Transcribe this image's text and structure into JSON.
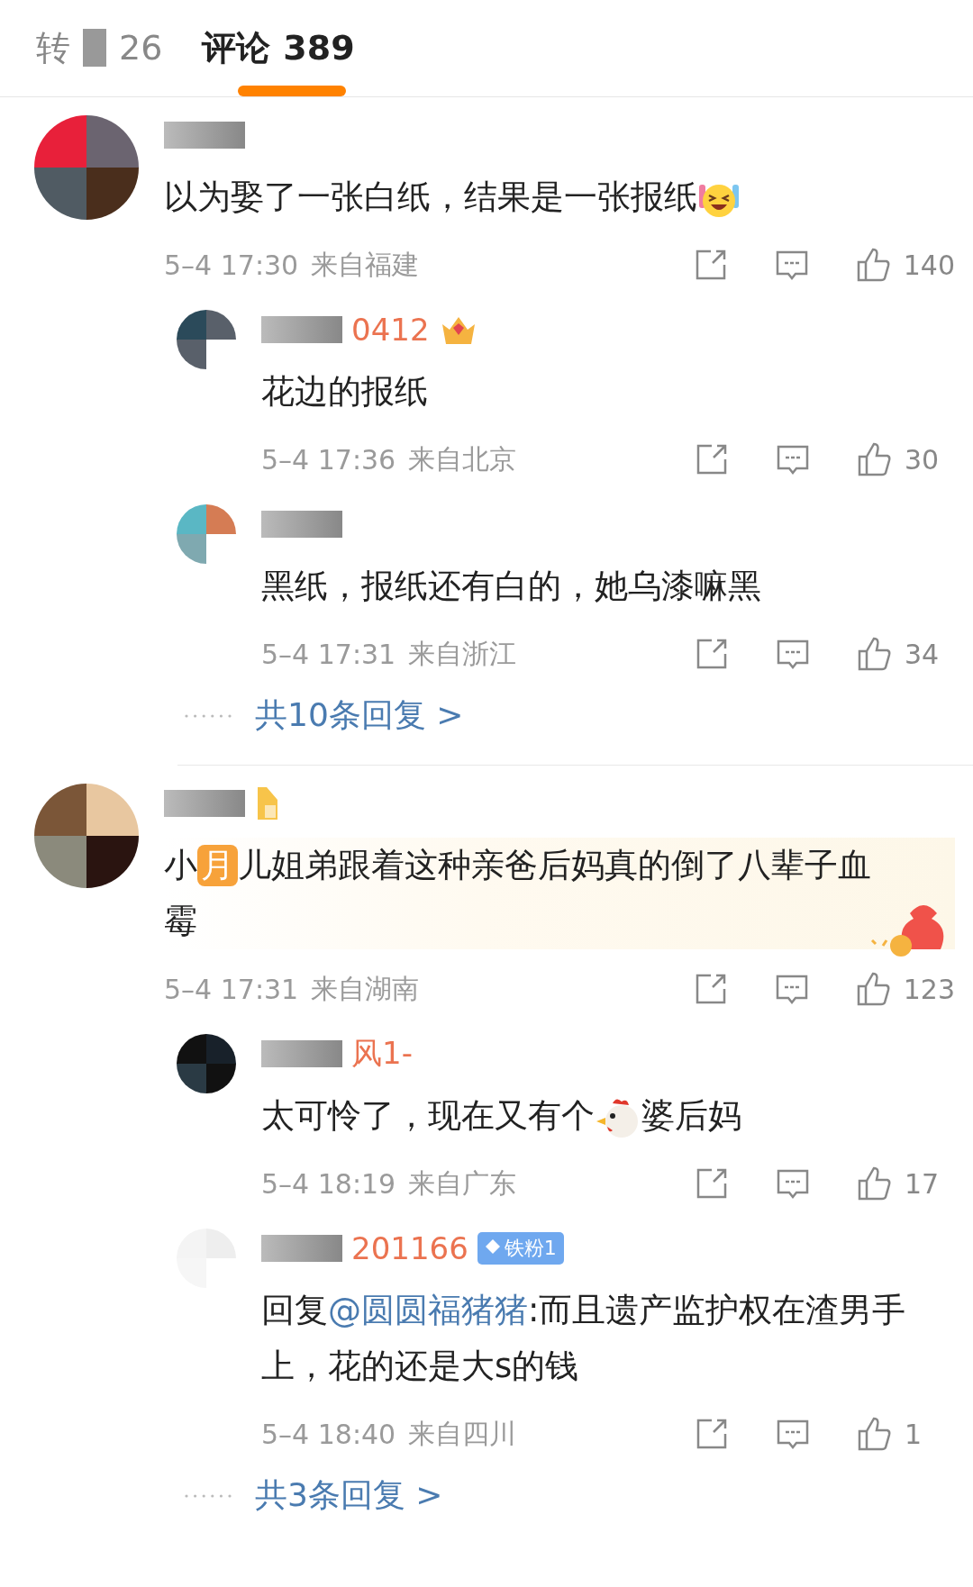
{
  "tabs": [
    {
      "label": "转",
      "count": "26",
      "selected": false
    },
    {
      "label": "评论",
      "count": "389",
      "selected": true
    }
  ],
  "comments": [
    {
      "highlighted": false,
      "segments": [
        {
          "kind": "plain",
          "text": "以为娶了一张白纸，结果是一张报纸"
        },
        {
          "kind": "emoji"
        }
      ],
      "time": "5–4 17:30",
      "location": "来自福建",
      "likes": "140",
      "replies": [
        {
          "name": "0412",
          "badge": {
            "kind": "crown"
          },
          "segments": [
            {
              "kind": "plain",
              "text": "花边的报纸"
            }
          ],
          "time": "5–4 17:36",
          "location": "来自北京",
          "likes": "30"
        },
        {
          "segments": [
            {
              "kind": "plain",
              "text": "黑纸，报纸还有白的，她乌漆嘛黑"
            }
          ],
          "time": "5–4 17:31",
          "location": "来自浙江",
          "likes": "34"
        }
      ],
      "more_replies": "共10条回复 >"
    },
    {
      "badge": {
        "kind": "medal"
      },
      "highlighted": true,
      "segments": [
        {
          "kind": "plain",
          "text": "小"
        },
        {
          "kind": "tag",
          "text": "月"
        },
        {
          "kind": "plain",
          "text": "儿姐弟跟着这种亲爸后妈真的倒了八辈子血霉"
        }
      ],
      "time": "5–4 17:31",
      "location": "来自湖南",
      "likes": "123",
      "replies": [
        {
          "name": "风1-",
          "segments": [
            {
              "kind": "plain",
              "text": "太可怜了，现在又有个"
            },
            {
              "kind": "chicken"
            },
            {
              "kind": "plain",
              "text": "婆后妈"
            }
          ],
          "time": "5–4 18:19",
          "location": "来自广东",
          "likes": "17"
        },
        {
          "name": "201166",
          "badge": {
            "kind": "fan",
            "text": "铁粉1"
          },
          "segments": [
            {
              "kind": "plain",
              "text": "回复"
            },
            {
              "kind": "mention",
              "text": "@圆圆福猪猪"
            },
            {
              "kind": "plain",
              "text": ":而且遗产监护权在渣男手上，花的还是大s的钱"
            }
          ],
          "time": "5–4 18:40",
          "location": "来自四川",
          "likes": "1"
        }
      ],
      "more_replies": "共3条回复 >"
    }
  ]
}
